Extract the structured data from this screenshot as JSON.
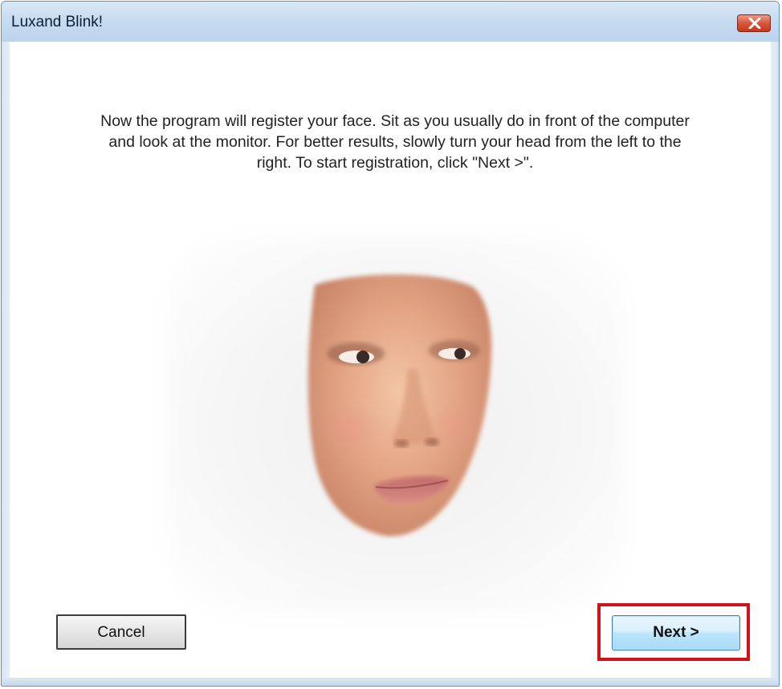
{
  "window": {
    "title": "Luxand Blink!"
  },
  "instructions": {
    "text": "Now the program will register your face. Sit as you usually do in front of the computer and look at the monitor. For better results, slowly turn your head from the left to the right. To start registration, click \"Next  >\"."
  },
  "buttons": {
    "cancel_label": "Cancel",
    "next_label": "Next >"
  },
  "icons": {
    "close": "close-icon",
    "face_image": "face-image"
  },
  "colors": {
    "highlight": "#d0121b",
    "next_button": "#bee6fd",
    "close_button": "#d8573b"
  }
}
